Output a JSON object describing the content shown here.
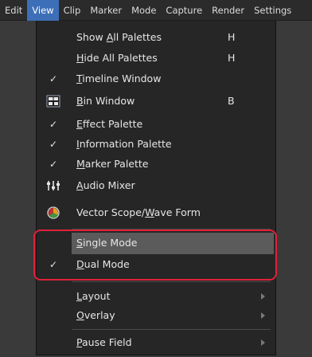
{
  "menubar": {
    "items": [
      "Edit",
      "View",
      "Clip",
      "Marker",
      "Mode",
      "Capture",
      "Render",
      "Settings"
    ],
    "active": "View"
  },
  "menu": {
    "show_all_palettes": {
      "pre": "Show ",
      "u": "A",
      "post": "ll Palettes",
      "shortcut": "H"
    },
    "hide_all_palettes": {
      "pre": "",
      "u": "H",
      "post": "ide All Palettes",
      "shortcut": "H"
    },
    "timeline_window": {
      "pre": "",
      "u": "T",
      "post": "imeline Window"
    },
    "bin_window": {
      "pre": "",
      "u": "B",
      "post": "in Window",
      "shortcut": "B"
    },
    "effect_palette": {
      "pre": "",
      "u": "E",
      "post": "ffect Palette"
    },
    "information_palette": {
      "pre": "",
      "u": "I",
      "post": "nformation  Palette"
    },
    "marker_palette": {
      "pre": "",
      "u": "M",
      "post": "arker Palette"
    },
    "audio_mixer": {
      "pre": "",
      "u": "A",
      "post": "udio Mixer"
    },
    "vector_scope": {
      "pre": "Vector Scope/",
      "u": "W",
      "post": "ave Form"
    },
    "single_mode": {
      "pre": "",
      "u": "S",
      "post": "ingle Mode"
    },
    "dual_mode": {
      "pre": "",
      "u": "D",
      "post": "ual Mode"
    },
    "layout": {
      "pre": "",
      "u": "L",
      "post": "ayout"
    },
    "overlay": {
      "pre": "",
      "u": "O",
      "post": "verlay"
    },
    "pause_field": {
      "pre": "",
      "u": "P",
      "post": "ause Field"
    }
  },
  "checkmark": "✓",
  "icons": {
    "bin": "grid-icon",
    "audio": "mixer-sliders-icon",
    "vector": "vector-scope-icon"
  },
  "colors": {
    "active_menu": "#3d6fb8",
    "highlight_box": "#e0213a",
    "hover_row": "#5b5b5b"
  }
}
